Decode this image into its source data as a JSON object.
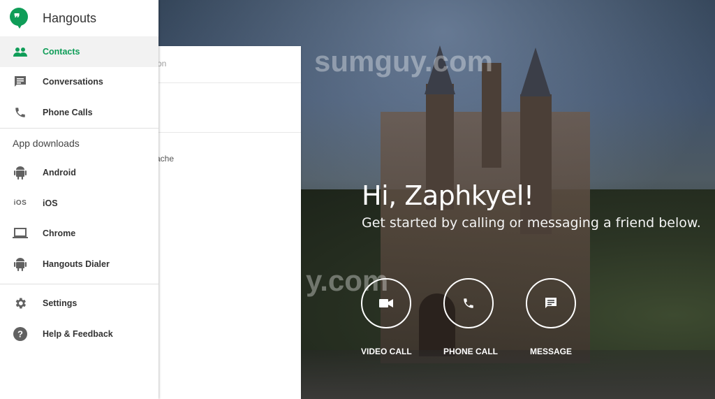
{
  "app": {
    "title": "Hangouts"
  },
  "nav": {
    "primary": [
      {
        "label": "Contacts",
        "icon": "people-icon",
        "active": true
      },
      {
        "label": "Conversations",
        "icon": "chat-icon"
      },
      {
        "label": "Phone Calls",
        "icon": "phone-icon"
      }
    ],
    "downloads_heading": "App downloads",
    "downloads": [
      {
        "label": "Android",
        "icon": "android-icon"
      },
      {
        "label": "iOS",
        "icon": "ios-icon",
        "icon_text": "iOS"
      },
      {
        "label": "Chrome",
        "icon": "laptop-icon"
      },
      {
        "label": "Hangouts Dialer",
        "icon": "android-icon"
      }
    ],
    "footer": [
      {
        "label": "Settings",
        "icon": "gear-icon"
      },
      {
        "label": "Help & Feedback",
        "icon": "help-icon"
      }
    ]
  },
  "panel": {
    "fragment_top": "on",
    "fragment_mid": "ache"
  },
  "greeting": {
    "title": "Hi, Zaphkyel!",
    "subtitle": "Get started by calling or messaging a friend below."
  },
  "actions": [
    {
      "label": "VIDEO CALL",
      "icon": "video-camera-icon"
    },
    {
      "label": "PHONE CALL",
      "icon": "phone-icon"
    },
    {
      "label": "MESSAGE",
      "icon": "message-icon"
    }
  ],
  "watermark": {
    "top": "sumguy.com",
    "mid": "y.com"
  },
  "colors": {
    "accent": "#0f9d58",
    "drawer_bg": "#ffffff"
  }
}
